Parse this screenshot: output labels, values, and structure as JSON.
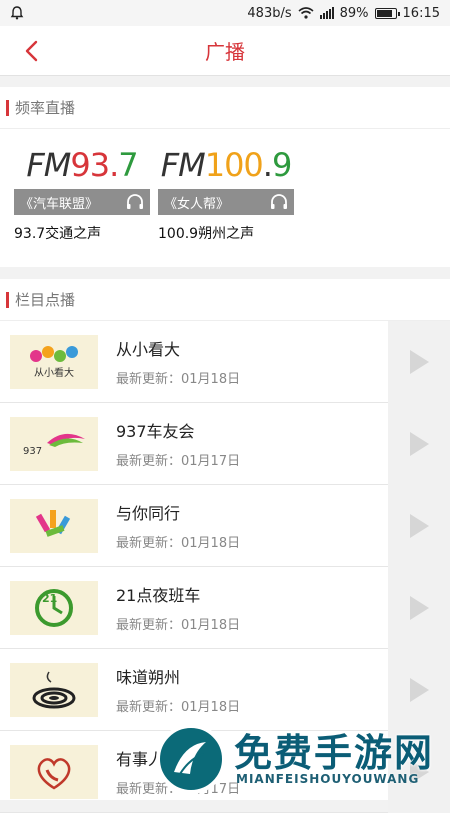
{
  "status": {
    "speed": "483b/s",
    "battery": "89%",
    "time": "16:15"
  },
  "header": {
    "title": "广播"
  },
  "frequency_section": {
    "title": "频率直播",
    "stations": [
      {
        "logo_prefix": "FM",
        "logo_num1": "93",
        "logo_dot": ".",
        "logo_num2": "7",
        "channel": "《汽车联盟》",
        "name": "93.7交通之声"
      },
      {
        "logo_prefix": "FM",
        "logo_num1": "100",
        "logo_dot": ".",
        "logo_num2": "9",
        "channel": "《女人帮》",
        "name": "100.9朔州之声"
      }
    ]
  },
  "programs_section": {
    "title": "栏目点播",
    "items": [
      {
        "title": "从小看大",
        "updated": "最新更新：01月18日",
        "thumb_text": "从小看大"
      },
      {
        "title": "937车友会",
        "updated": "最新更新：01月17日",
        "thumb_text": "937"
      },
      {
        "title": "与你同行",
        "updated": "最新更新：01月18日",
        "thumb_text": ""
      },
      {
        "title": "21点夜班车",
        "updated": "最新更新：01月18日",
        "thumb_text": "21"
      },
      {
        "title": "味道朔州",
        "updated": "最新更新：01月18日",
        "thumb_text": ""
      },
      {
        "title": "有事人帮",
        "updated": "最新更新：01月17日",
        "thumb_text": ""
      }
    ]
  },
  "watermark": {
    "title": "免费手游网",
    "subtitle": "MIANFEISHOUYOUWANG"
  },
  "colors": {
    "accent": "#d7353a",
    "fm_orange": "#f0a21a",
    "fm_green": "#2e9a3e",
    "fm_red": "#d7353a"
  }
}
